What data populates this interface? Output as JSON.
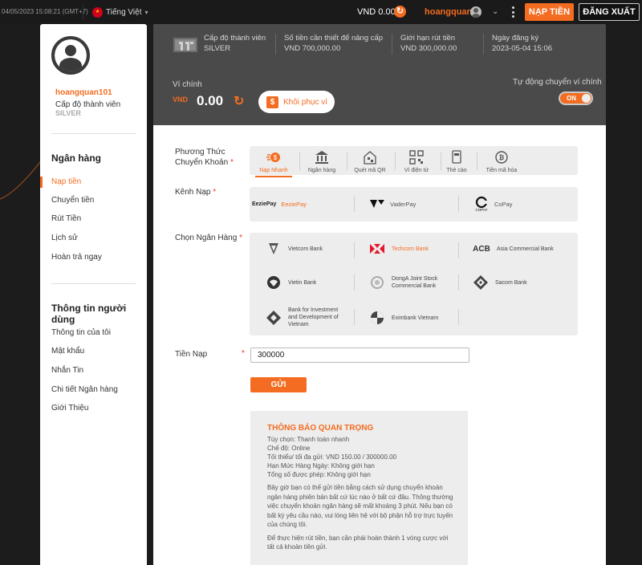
{
  "topbar": {
    "datetime": "04/05/2023 15:08:21 (GMT+7)",
    "language": "Tiếng Việt",
    "balance": "VND 0.00",
    "username": "hoangquan...",
    "deposit_button": "NẠP TIỀN",
    "logout_button": "ĐĂNG XUẤT"
  },
  "sidebar": {
    "username": "hoangquan101",
    "level_label": "Cấp độ thành viên",
    "level_value": "SILVER",
    "section_bank": "Ngân hàng",
    "bank_items": [
      {
        "label": "Nạp tiền",
        "active": true
      },
      {
        "label": "Chuyển tiền"
      },
      {
        "label": "Rút Tiền"
      },
      {
        "label": "Lịch sử"
      },
      {
        "label": "Hoàn trả ngay"
      }
    ],
    "section_user": "Thông tin người dùng",
    "user_items": [
      {
        "label": "Thông tin của tôi"
      },
      {
        "label": "Mật khẩu"
      },
      {
        "label": "Nhắn Tin"
      },
      {
        "label": "Chi tiết Ngân hàng"
      },
      {
        "label": "Giới Thiệu"
      }
    ]
  },
  "header": {
    "stats": [
      {
        "label": "Cấp độ thành viên",
        "value": "SILVER"
      },
      {
        "label": "Số tiền cần thiết để nâng cấp",
        "value": "VND 700,000.00"
      },
      {
        "label": "Giới hạn rút tiền",
        "value": "VND 300,000.00"
      },
      {
        "label": "Ngày đăng ký",
        "value": "2023-05-04 15:06"
      }
    ],
    "wallet_label": "Ví chính",
    "wallet_currency": "VND",
    "wallet_amount": "0.00",
    "restore_button": "Khôi phục ví",
    "auto_transfer_label": "Tự động chuyển ví chính",
    "toggle_state": "ON"
  },
  "form": {
    "method_label_line1": "Phương Thức",
    "method_label_line2": "Chuyển Khoản",
    "methods": [
      {
        "label": "Nạp Nhanh",
        "icon": "fast-deposit-icon",
        "active": true
      },
      {
        "label": "Ngân hàng",
        "icon": "bank-icon"
      },
      {
        "label": "Quét mã QR",
        "icon": "qr-shop-icon"
      },
      {
        "label": "Ví điện tử",
        "icon": "qr-code-icon"
      },
      {
        "label": "Thẻ cào",
        "icon": "scratch-card-icon"
      },
      {
        "label": "Tiền mã hóa",
        "icon": "crypto-coin-icon"
      }
    ],
    "channel_label": "Kênh Nạp",
    "channels": [
      {
        "logo": "EeziePay",
        "label": "EeziePay"
      },
      {
        "logo": "",
        "label": "VaderPay"
      },
      {
        "logo": "COPAY",
        "label": "CoPay"
      }
    ],
    "bank_label": "Chọn Ngân Hàng",
    "banks": [
      {
        "label": "Vietcom Bank",
        "icon": "vietcombank-icon"
      },
      {
        "label": "Techcom Bank",
        "icon": "techcombank-icon",
        "active": true
      },
      {
        "label": "Asia Commercial Bank",
        "icon": "acb-icon",
        "logo": "ACB"
      },
      {
        "label": "Vietin Bank",
        "icon": "vietinbank-icon"
      },
      {
        "label": "DongA Joint Stock Commercial Bank",
        "icon": "donga-bank-icon"
      },
      {
        "label": "Sacom Bank",
        "icon": "sacombank-icon"
      },
      {
        "label": "Bank for Investment and Development of Vietnam",
        "icon": "bidv-icon"
      },
      {
        "label": "Eximbank Vietnam",
        "icon": "eximbank-icon"
      }
    ],
    "amount_label": "Tiền Nạp",
    "amount_value": "300000",
    "submit_button": "GỬI"
  },
  "notice": {
    "title": "THÔNG BÁO QUAN TRỌNG",
    "lines": [
      "Tùy chọn: Thanh toán nhanh",
      "Chế độ: Online",
      "Tối thiểu/ tối đa gửi: VND 150.00 / 300000.00",
      "Hạn Mức Hàng Ngày: Không giới hạn",
      "Tổng số được phép: Không giới hạn"
    ],
    "para1": "Bây giờ bạn có thể gửi tiền bằng cách sử dụng chuyển khoản ngân hàng phiên bản bất cứ lúc nào ở bất cứ đâu. Thông thường việc chuyển khoản ngân hàng sẽ mất khoảng 3 phút. Nếu bạn có bất kỳ yêu cầu nào, vui lòng liên hệ với bộ phận hỗ trợ trực tuyến của chúng tôi.",
    "para2": "Để thực hiện rút tiền, bạn cần phải hoàn thành 1 vòng cược với tất cả khoản tiền gửi."
  },
  "colors": {
    "accent": "#f36c21",
    "header_bg": "#4a4a4a",
    "panel_bg": "#ededed"
  }
}
